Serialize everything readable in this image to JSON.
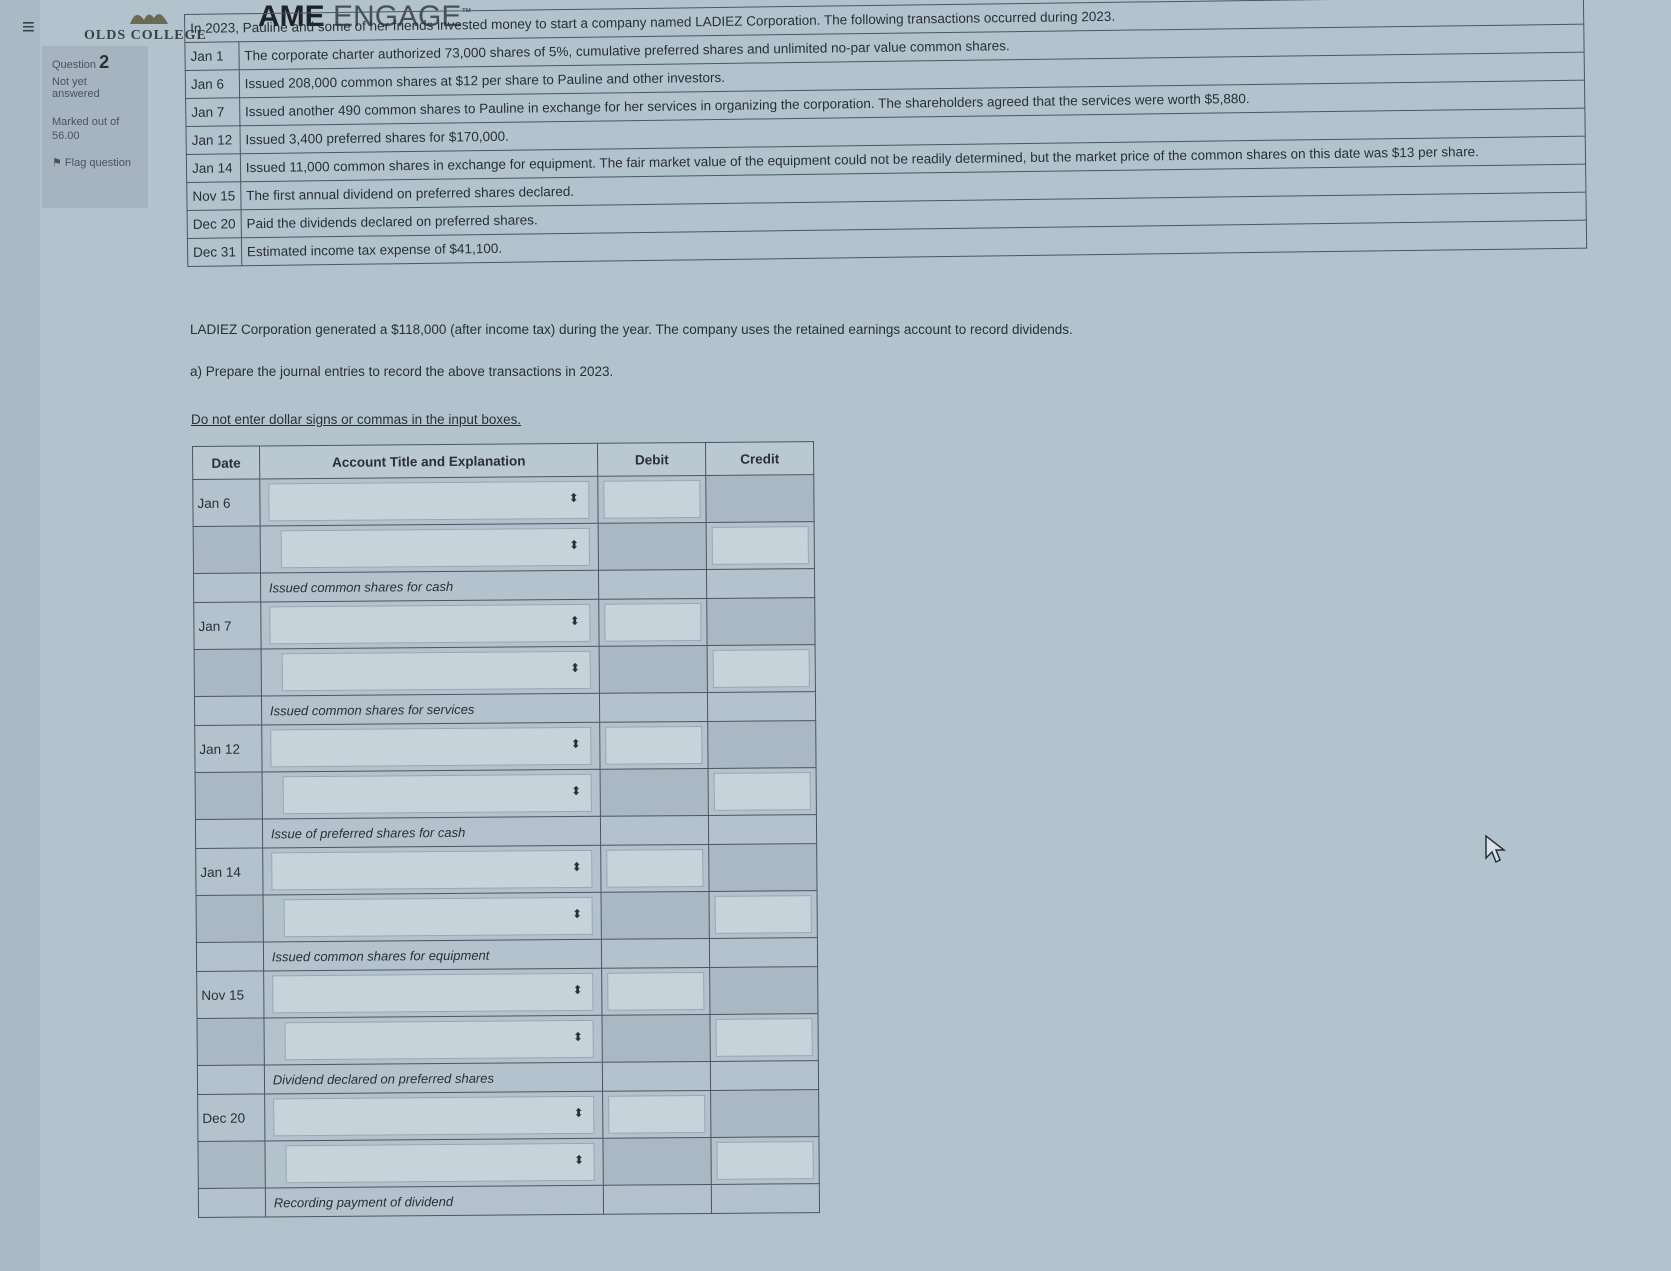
{
  "header": {
    "college": "OLDS COLLEGE",
    "brand_bold": "AME",
    "brand_light": "ENGAGE",
    "brand_mark": "™"
  },
  "question_info": {
    "label": "Question",
    "number": "2",
    "status": "Not yet answered",
    "marked": "Marked out of",
    "marks": "56.00",
    "flag": "Flag question"
  },
  "transactions": {
    "intro": "In 2023, Pauline and some of her friends invested money to start a company named LADIEZ Corporation. The following transactions occurred during 2023.",
    "rows": [
      {
        "date": "Jan 1",
        "text": "The corporate charter authorized 73,000 shares of 5%, cumulative preferred shares and unlimited no-par value common shares."
      },
      {
        "date": "Jan 6",
        "text": "Issued 208,000 common shares at $12 per share to Pauline and other investors."
      },
      {
        "date": "Jan 7",
        "text": "Issued another 490 common shares to Pauline in exchange for her services in organizing the corporation. The shareholders agreed that the services were worth $5,880."
      },
      {
        "date": "Jan 12",
        "text": "Issued 3,400 preferred shares for $170,000."
      },
      {
        "date": "Jan 14",
        "text": "Issued 11,000 common shares in exchange for equipment. The fair market value of the equipment could not be readily determined, but the market price of the common shares on this date was $13 per share."
      },
      {
        "date": "Nov 15",
        "text": "The first annual dividend on preferred shares declared."
      },
      {
        "date": "Dec 20",
        "text": "Paid the dividends declared on preferred shares."
      },
      {
        "date": "Dec 31",
        "text": "Estimated income tax expense of $41,100."
      }
    ]
  },
  "text": {
    "net_income": "LADIEZ Corporation generated a $118,000 (after income tax) during the year. The company uses the retained earnings account to record dividends.",
    "part_a": "a) Prepare the journal entries to record the above transactions in 2023.",
    "instruction": "Do not enter dollar signs or commas in the input boxes."
  },
  "journal": {
    "headers": {
      "date": "Date",
      "account": "Account Title and Explanation",
      "debit": "Debit",
      "credit": "Credit"
    },
    "entries": [
      {
        "date": "Jan 6",
        "memo": "Issued common shares for cash"
      },
      {
        "date": "Jan 7",
        "memo": "Issued common shares for services"
      },
      {
        "date": "Jan 12",
        "memo": "Issue of preferred shares for cash"
      },
      {
        "date": "Jan 14",
        "memo": "Issued common shares for equipment"
      },
      {
        "date": "Nov 15",
        "memo": "Dividend declared on preferred shares"
      },
      {
        "date": "Dec 20",
        "memo": "Recording payment of dividend"
      }
    ]
  },
  "icons": {
    "menu": "hamburger-icon",
    "select": "updown-arrows-icon",
    "cursor": "mouse-pointer-icon",
    "flag": "flag-icon"
  }
}
